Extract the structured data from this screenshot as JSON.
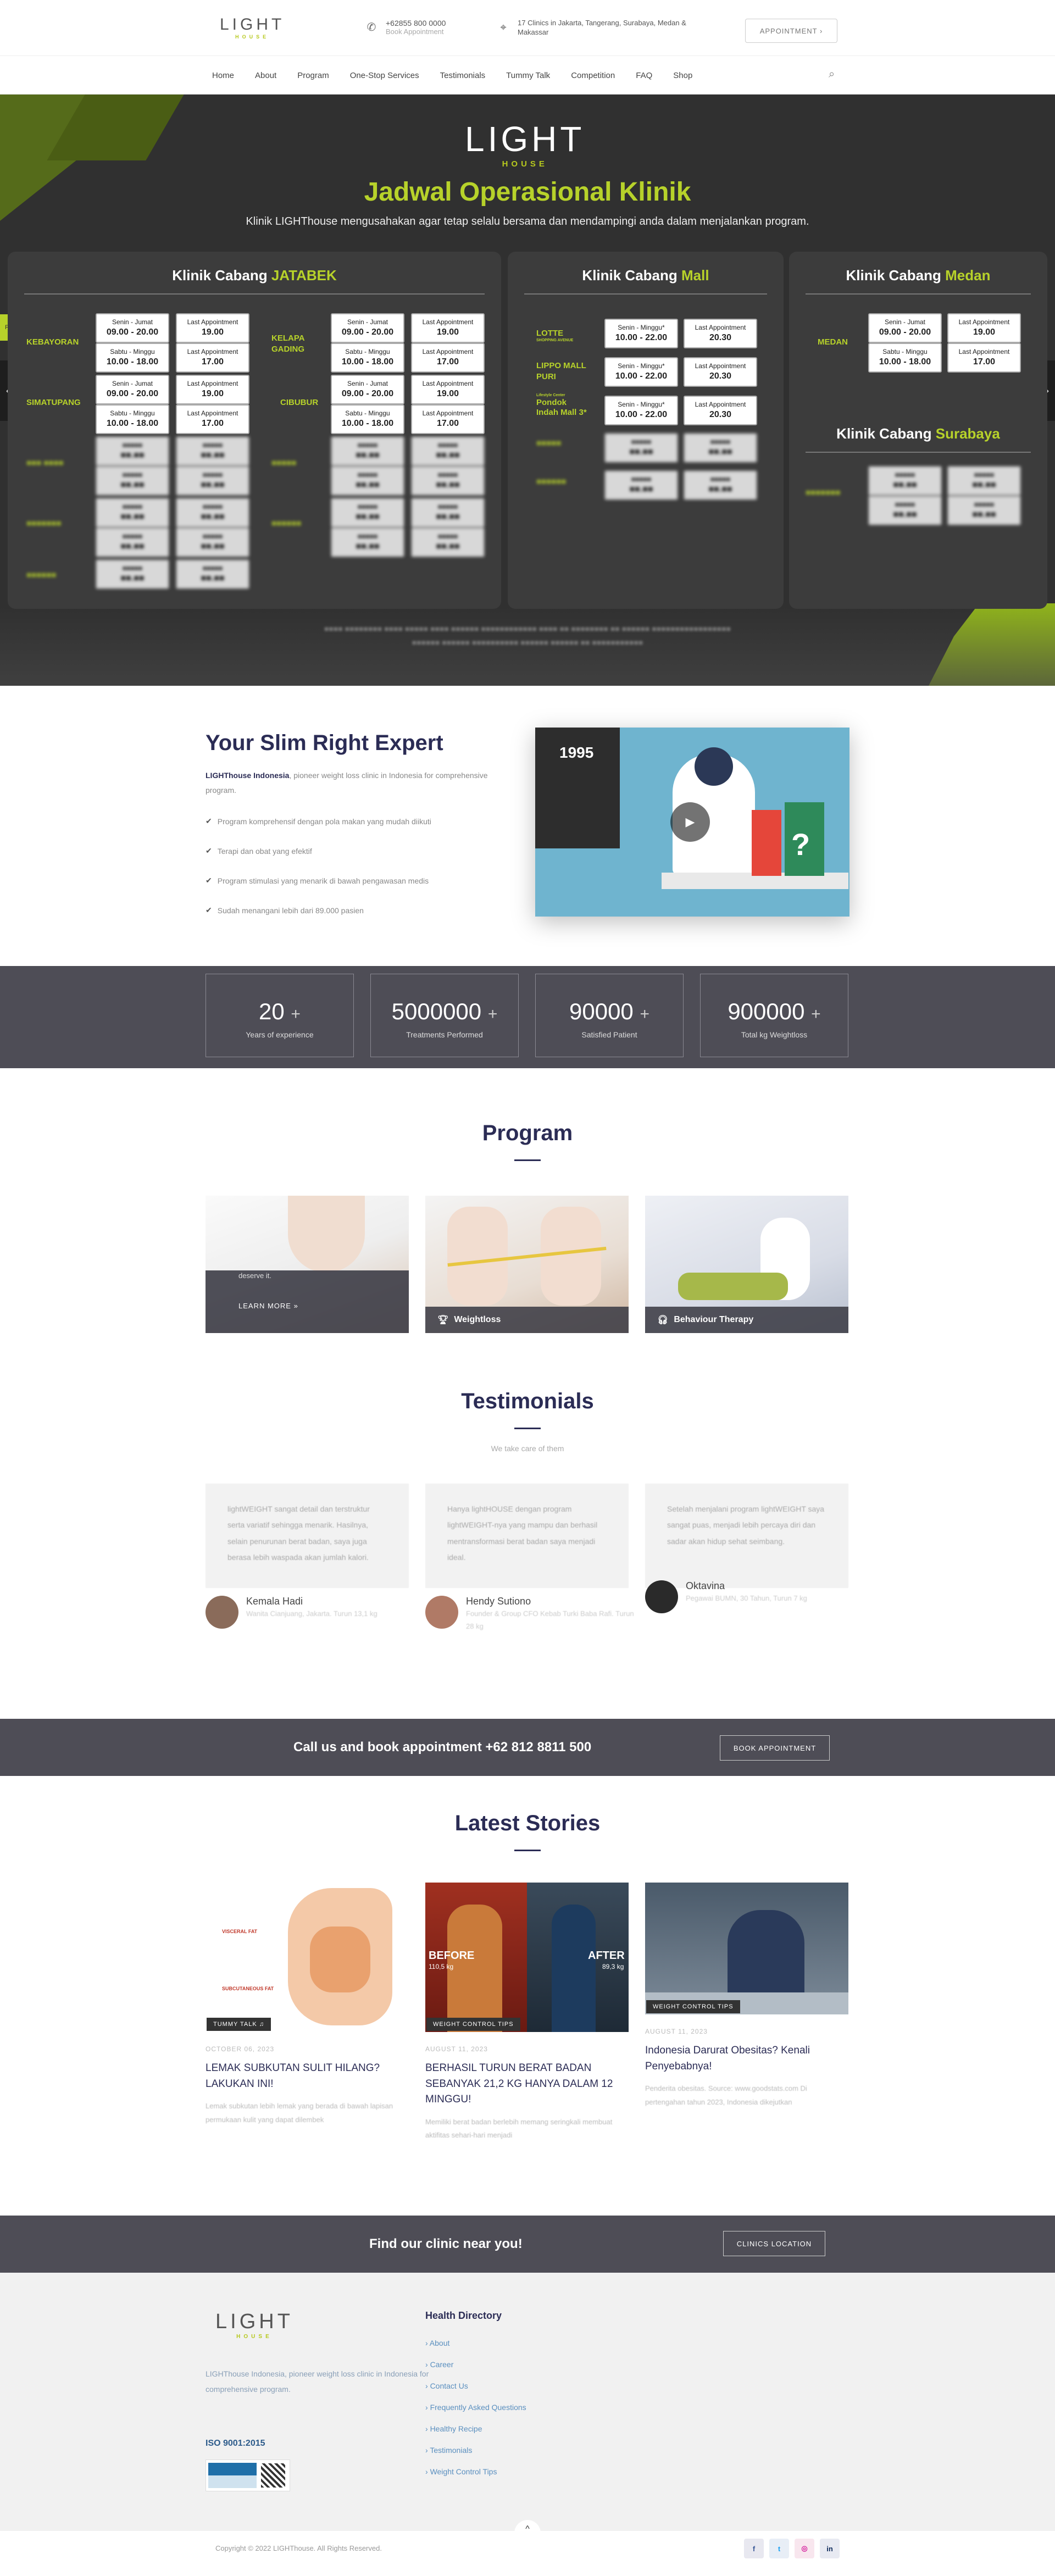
{
  "header": {
    "logo_text": "LIGHT",
    "logo_sub": "HOUSE",
    "phone": "+62855 800 0000",
    "phone_sub": "Book Appointment",
    "clinics": "17 Clinics in Jakarta, Tangerang, Surabaya, Medan &",
    "clinics2": "Makassar",
    "appointment_btn": "APPOINTMENT ›",
    "phone_icon": "whatsapp-icon",
    "location_icon": "map-pin-icon"
  },
  "nav": {
    "items": [
      "Home",
      "About",
      "Program",
      "One-Stop Services",
      "Testimonials",
      "Tummy Talk",
      "Competition",
      "FAQ",
      "Shop"
    ],
    "search_icon": "search-icon"
  },
  "hero": {
    "title": "Jadwal Operasional Klinik",
    "subtitle": "Klinik LIGHThouse mengusahakan agar tetap selalu bersama dan mendampingi anda dalam menjalankan program.",
    "side_tab": "FAQ",
    "panels": {
      "jatabek": {
        "prefix": "Klinik Cabang ",
        "accent": "JATABEK"
      },
      "mall": {
        "prefix": "Klinik Cabang ",
        "accent": "Mall"
      },
      "medan": {
        "prefix": "Klinik Cabang ",
        "accent": "Medan"
      },
      "surabaya": {
        "prefix": "Klinik Cabang ",
        "accent": "Surabaya"
      }
    },
    "locations": {
      "kebayoran": "KEBAYORAN",
      "simatupang": "SIMATUPANG",
      "kelapa": "KELAPA",
      "gading": "GADING",
      "cibubur": "CIBUBUR",
      "lotte": "LOTTE",
      "lotte_sub": "SHOPPING AVENUE",
      "lippo": "LIPPO MALL",
      "lippo2": "PURI",
      "pondok_pre": "Lifestyle Center",
      "pondok": "Pondok",
      "pondok2": "Indah Mall 3*",
      "medan": "MEDAN"
    },
    "schedule": {
      "wd_label": "Senin - Jumat",
      "wd_time": "09.00 - 20.00",
      "we_label": "Sabtu - Minggu",
      "we_time": "10.00 - 18.00",
      "la_label": "Last Appointment",
      "la_19": "19.00",
      "la_17": "17.00",
      "la_2030": "20.30",
      "mall_label": "Senin - Minggu*",
      "mall_time": "10.00 - 22.00"
    },
    "colors": {
      "accent": "#b7d22a",
      "dark": "#303030"
    }
  },
  "expert": {
    "title": "Your Slim Right Expert",
    "brand": "LIGHThouse Indonesia",
    "desc": ", pioneer weight loss clinic in Indonesia for comprehensive program.",
    "checks": [
      "Program komprehensif dengan pola makan yang mudah diikuti",
      "Terapi dan obat yang efektif",
      "Program stimulasi yang menarik di bawah pengawasan medis",
      "Sudah menangani lebih dari 89.000 pasien"
    ],
    "video_year": "1995",
    "play_icon": "play-icon"
  },
  "stats": [
    {
      "num": "20",
      "plus": "+",
      "label": "Years of experience"
    },
    {
      "num": "5000000",
      "plus": "+",
      "label": "Treatments Performed"
    },
    {
      "num": "90000",
      "plus": "+",
      "label": "Satisfied Patient"
    },
    {
      "num": "900000",
      "plus": "+",
      "label": "Total kg Weightloss"
    }
  ],
  "program": {
    "title": "Program",
    "cards": [
      {
        "overlay_text": "deserve it.",
        "learn_more": "LEARN MORE »"
      },
      {
        "label": "Weightloss",
        "icon": "trophy-icon"
      },
      {
        "label": "Behaviour Therapy",
        "icon": "headphones-icon"
      }
    ]
  },
  "testimonials": {
    "title": "Testimonials",
    "subtitle": "We take care of them",
    "items": [
      {
        "text": "lightWEIGHT sangat detail dan terstruktur serta variatif sehingga menarik. Hasilnya, selain penurunan berat badan, saya juga berasa lebih waspada akan jumlah kalori.",
        "name": "Kemala Hadi",
        "desc": "Wanita Cianjuang, Jakarta. Turun 13,1 kg"
      },
      {
        "text": "Hanya lightHOUSE dengan program lightWEIGHT-nya yang mampu dan berhasil mentransformasi berat badan saya menjadi ideal.",
        "name": "Hendy Sutiono",
        "desc": "Founder & Group CFO Kebab Turki Baba Rafi. Turun 28 kg"
      },
      {
        "text": "Setelah menjalani program lightWEIGHT saya sangat puas, menjadi lebih percaya diri dan sadar akan hidup sehat seimbang.",
        "name": "Oktavina",
        "desc": "Pegawai BUMN, 30 Tahun, Turun 7 kg"
      }
    ]
  },
  "cta1": {
    "text": "Call us and book appointment +62 812 8811 500",
    "button": "BOOK APPOINTMENT"
  },
  "stories": {
    "title": "Latest Stories",
    "items": [
      {
        "tag": "TUMMY TALK",
        "date": "OCTOBER 06, 2023",
        "title": "LEMAK SUBKUTAN SULIT HILANG? LAKUKAN INI!",
        "excerpt": "Lemak subkutan lebih lemak yang berada di bawah lapisan permukaan kulit yang dapat dilembek",
        "img_label1": "VISCERAL FAT",
        "img_label2": "SUBCUTANEOUS FAT"
      },
      {
        "tag": "WEIGHT CONTROL TIPS",
        "date": "AUGUST 11, 2023",
        "title": "BERHASIL TURUN BERAT BADAN SEBANYAK 21,2 KG HANYA DALAM 12 MINGGU!",
        "excerpt": "Memiliki berat badan berlebih memang seringkali membuat aktifitas sehari-hari menjadi",
        "before": "BEFORE",
        "before_kg": "110,5 kg",
        "after": "AFTER",
        "after_kg": "89,3 kg"
      },
      {
        "tag": "WEIGHT CONTROL TIPS",
        "date": "AUGUST 11, 2023",
        "title": "Indonesia Darurat Obesitas? Kenali Penyebabnya!",
        "excerpt": "Penderita obesitas. Source: www.goodstats.com Di pertengahan tahun 2023, Indonesia dikejutkan"
      }
    ]
  },
  "cta2": {
    "text": "Find our clinic near you!",
    "button": "CLINICS LOCATION"
  },
  "footer": {
    "desc": "LIGHThouse Indonesia, pioneer weight loss clinic in Indonesia for comprehensive program.",
    "iso": "ISO 9001:2015",
    "directory_title": "Health Directory",
    "links": [
      "About",
      "Career",
      "Contact Us",
      "Frequently Asked Questions",
      "Healthy Recipe",
      "Testimonials",
      "Weight Control Tips"
    ],
    "copyright": "Copyright © 2022 LIGHThouse. All Rights Reserved.",
    "social": [
      {
        "icon": "facebook-icon",
        "glyph": "f"
      },
      {
        "icon": "twitter-icon",
        "glyph": "t"
      },
      {
        "icon": "instagram-icon",
        "glyph": "◎"
      },
      {
        "icon": "linkedin-icon",
        "glyph": "in"
      }
    ],
    "to_top": "^"
  }
}
